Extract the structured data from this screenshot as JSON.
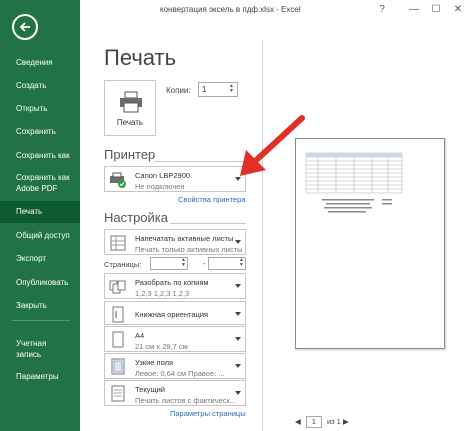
{
  "window": {
    "title": "конвертация эксель в пдф.xlsx - Excel",
    "help": "?",
    "minimize": "—",
    "restore": "☐",
    "close": "✕"
  },
  "sidebar": {
    "items": [
      {
        "label": "Сведения"
      },
      {
        "label": "Создать"
      },
      {
        "label": "Открыть"
      },
      {
        "label": "Сохранить"
      },
      {
        "label": "Сохранить как"
      },
      {
        "label": "Сохранить как Adobe PDF"
      },
      {
        "label": "Печать",
        "active": true
      },
      {
        "label": "Общий доступ"
      },
      {
        "label": "Экспорт"
      },
      {
        "label": "Опубликовать"
      },
      {
        "label": "Закрыть"
      },
      {
        "label": "Учетная запись"
      },
      {
        "label": "Параметры"
      }
    ]
  },
  "main": {
    "title": "Печать",
    "print_button": "Печать",
    "copies_label": "Копии:",
    "copies_value": "1",
    "printer_section": "Принтер",
    "printer": {
      "name": "Canon LBP2900",
      "status": "Не подключен"
    },
    "printer_properties": "Свойства принтера",
    "settings_section": "Настройка",
    "settings": [
      {
        "t1": "Напечатать активные листы",
        "t2": "Печать только активных листы"
      },
      {
        "t1": "Разобрать по копиям",
        "t2": "1,2,3    1,2,3    1,2,3"
      },
      {
        "t1": "Книжная ориентация",
        "t2": ""
      },
      {
        "t1": "A4",
        "t2": "21 см x 29,7 см"
      },
      {
        "t1": "Узкие поля",
        "t2": "Левое: 0,64 см   Правое: ..."
      },
      {
        "t1": "Текущий",
        "t2": "Печать листов с фактическ..."
      }
    ],
    "pages_label": "Страницы:",
    "pages_dash": "-",
    "page_setup": "Параметры страницы"
  },
  "preview": {
    "current_page": "1",
    "of_label": "из 1"
  },
  "colors": {
    "sidebar": "#217346",
    "active": "#0f5a2e",
    "link": "#2d6bb5",
    "arrow": "#e0302a"
  }
}
